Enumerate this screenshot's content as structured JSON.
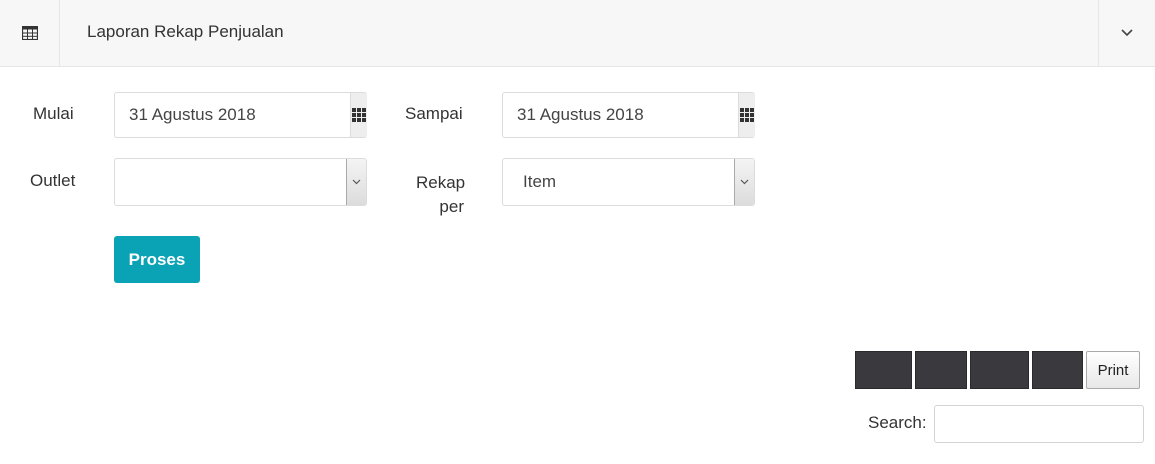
{
  "header": {
    "title": "Laporan Rekap Penjualan",
    "icon": "table-icon",
    "toggle_icon": "chevron-down-icon"
  },
  "form": {
    "mulai": {
      "label": "Mulai",
      "value": "31 Agustus 2018",
      "icon": "calendar-grid-icon"
    },
    "sampai": {
      "label": "Sampai",
      "value": "31 Agustus 2018",
      "icon": "calendar-grid-icon"
    },
    "outlet": {
      "label": "Outlet",
      "value": ""
    },
    "rekap": {
      "label_line1": "Rekap",
      "label_line2": "per",
      "value": "Item"
    },
    "proses_label": "Proses"
  },
  "toolbar": {
    "print_label": "Print"
  },
  "search": {
    "label": "Search:",
    "value": ""
  }
}
